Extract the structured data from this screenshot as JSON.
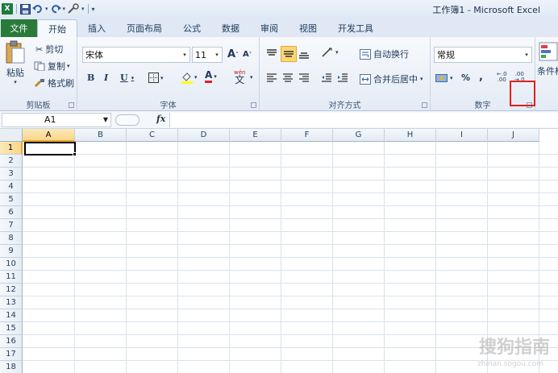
{
  "window": {
    "title": "工作簿1 - Microsoft Excel"
  },
  "qat": {
    "app_icon": "X",
    "save": "💾",
    "undo": "↶",
    "redo": "↷",
    "custom": "▾"
  },
  "tabs": {
    "file": "文件",
    "items": [
      {
        "label": "开始",
        "active": true
      },
      {
        "label": "插入"
      },
      {
        "label": "页面布局"
      },
      {
        "label": "公式"
      },
      {
        "label": "数据"
      },
      {
        "label": "审阅"
      },
      {
        "label": "视图"
      },
      {
        "label": "开发工具"
      }
    ]
  },
  "ribbon": {
    "clipboard": {
      "label": "剪贴板",
      "paste": "粘贴",
      "cut": "剪切",
      "copy": "复制",
      "format_painter": "格式刷"
    },
    "font": {
      "label": "字体",
      "font_name": "宋体",
      "font_size": "11",
      "grow": "A",
      "shrink": "A",
      "bold": "B",
      "italic": "I",
      "underline": "U",
      "phonetic": "wén"
    },
    "alignment": {
      "label": "对齐方式",
      "wrap_text": "自动换行",
      "merge_center": "合并后居中"
    },
    "number": {
      "label": "数字",
      "format": "常规",
      "percent": "%",
      "comma": ","
    },
    "styles": {
      "conditional": "条件格"
    }
  },
  "formula_bar": {
    "name_box": "A1",
    "fx": "fx",
    "value": ""
  },
  "grid": {
    "columns": [
      "A",
      "B",
      "C",
      "D",
      "E",
      "F",
      "G",
      "H",
      "I",
      "J"
    ],
    "rows": [
      "1",
      "2",
      "3",
      "4",
      "5",
      "6",
      "7",
      "8",
      "9",
      "10",
      "11",
      "12",
      "13",
      "14",
      "15",
      "16",
      "17",
      "18"
    ],
    "active_cell": "A1"
  },
  "watermark": {
    "text": "搜狗指南",
    "sub": "zhinan.sogou.com"
  },
  "colors": {
    "file_tab": "#2a7a3a",
    "highlight": "#e02020",
    "active_header": "#f8d68a"
  }
}
